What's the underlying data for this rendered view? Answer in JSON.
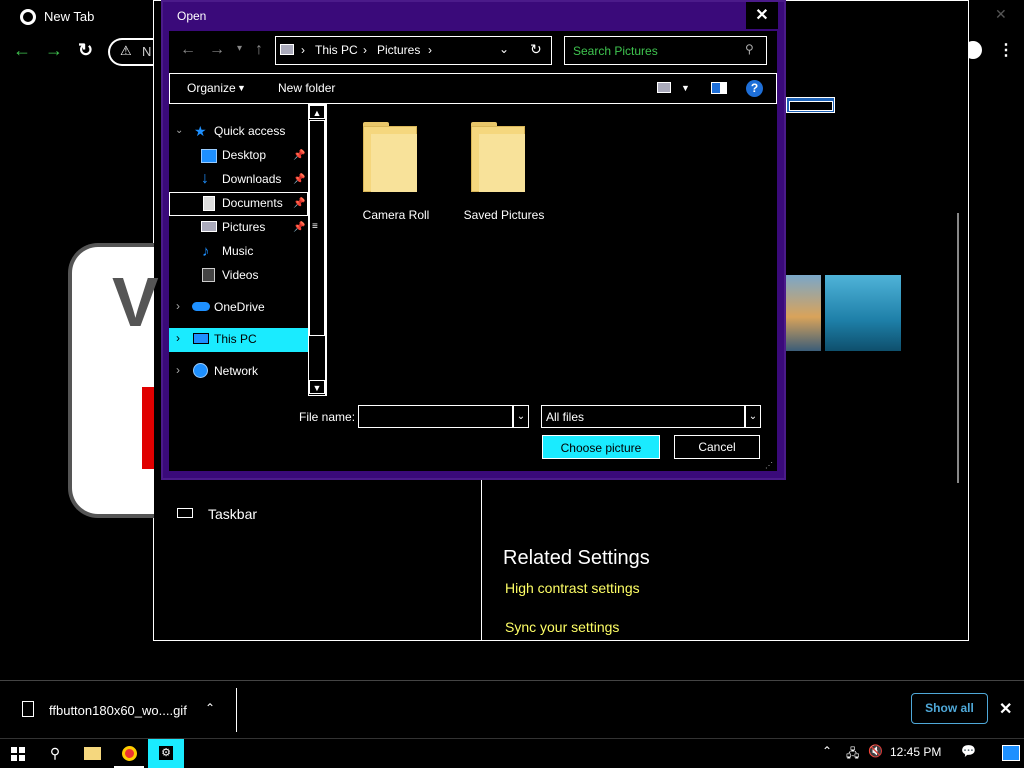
{
  "chrome": {
    "tab_title": "New Tab",
    "omnibox_text": "N",
    "minimize": "—",
    "maximize": "□",
    "close": "✕"
  },
  "settings_window": {
    "taskbar_label": "Taskbar",
    "related_title": "Related Settings",
    "links": [
      "High contrast settings",
      "Sync your settings"
    ]
  },
  "dialog": {
    "title": "Open",
    "close": "✕",
    "breadcrumb": [
      "This PC",
      "Pictures"
    ],
    "search_placeholder": "Search Pictures",
    "organize": "Organize",
    "new_folder": "New folder",
    "help": "?",
    "tree": {
      "quick_access": "Quick access",
      "desktop": "Desktop",
      "downloads": "Downloads",
      "documents": "Documents",
      "pictures": "Pictures",
      "music": "Music",
      "videos": "Videos",
      "onedrive": "OneDrive",
      "this_pc": "This PC",
      "network": "Network"
    },
    "folders": [
      "Camera Roll",
      "Saved Pictures"
    ],
    "file_name_label": "File name:",
    "file_name_value": "",
    "file_type": "All files",
    "choose_button": "Choose picture",
    "cancel_button": "Cancel"
  },
  "downloads": {
    "file_name": "ffbutton180x60_wo....gif",
    "show_all": "Show all"
  },
  "taskbar": {
    "clock": "12:45 PM"
  },
  "colors": {
    "accent_cyan": "#1aebff",
    "title_purple": "#3a0a7a",
    "link_yellow": "#ffff66",
    "nav_green": "#3fc44f"
  }
}
